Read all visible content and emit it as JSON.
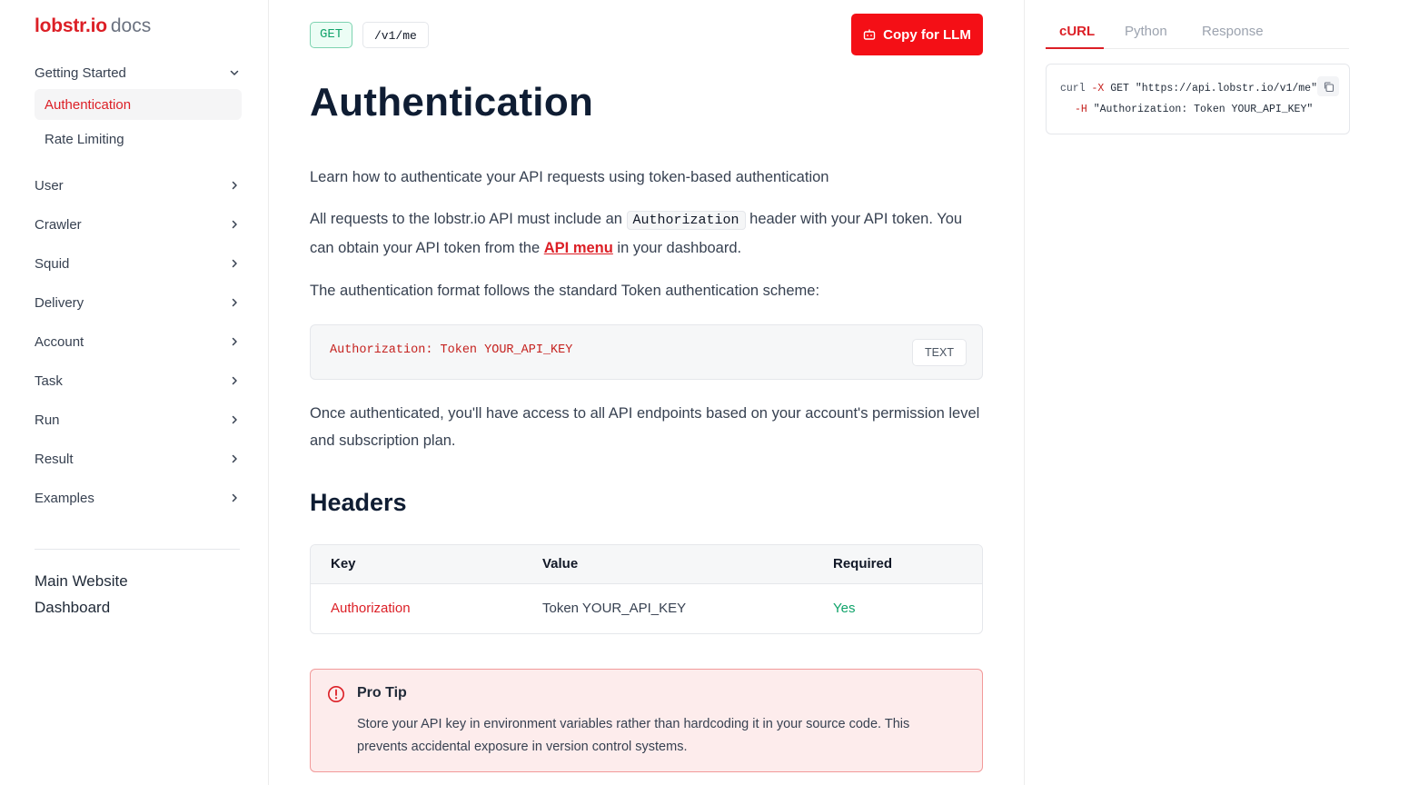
{
  "brand": {
    "logo": "lobstr.io",
    "suffix": "docs"
  },
  "sidebar": {
    "group": {
      "label": "Getting Started"
    },
    "sub_items": [
      {
        "label": "Authentication",
        "active": true
      },
      {
        "label": "Rate Limiting",
        "active": false
      }
    ],
    "items": [
      {
        "label": "User"
      },
      {
        "label": "Crawler"
      },
      {
        "label": "Squid"
      },
      {
        "label": "Delivery"
      },
      {
        "label": "Account"
      },
      {
        "label": "Task"
      },
      {
        "label": "Run"
      },
      {
        "label": "Result"
      },
      {
        "label": "Examples"
      }
    ],
    "footer_links": [
      {
        "label": "Main Website"
      },
      {
        "label": "Dashboard"
      }
    ]
  },
  "main": {
    "method": "GET",
    "path": "/v1/me",
    "copy_button": "Copy for LLM",
    "title": "Authentication",
    "intro": "Learn how to authenticate your API requests using token-based authentication",
    "para2": {
      "before": "All requests to the lobstr.io API must include an ",
      "code": "Authorization",
      "middle": " header with your API token. You can obtain your API token from the ",
      "link": "API menu",
      "after": " in your dashboard."
    },
    "para3": "The authentication format follows the standard Token authentication scheme:",
    "code_block": {
      "code": "Authorization: Token YOUR_API_KEY",
      "lang": "TEXT"
    },
    "para4": "Once authenticated, you'll have access to all API endpoints based on your account's permission level and subscription plan.",
    "headers_title": "Headers",
    "table": {
      "columns": [
        "Key",
        "Value",
        "Required"
      ],
      "rows": [
        {
          "key": "Authorization",
          "value": "Token YOUR_API_KEY",
          "required": "Yes"
        }
      ]
    },
    "tip": {
      "title": "Pro Tip",
      "body": "Store your API key in environment variables rather than hardcoding it in your source code. This prevents accidental exposure in version control systems."
    }
  },
  "right": {
    "tabs": [
      {
        "label": "cURL",
        "active": true
      },
      {
        "label": "Python",
        "active": false
      },
      {
        "label": "Response",
        "active": false
      }
    ],
    "snippet": {
      "line1_cmd": "curl",
      "line1_flag": "-X",
      "line1_rest": "GET \"https://api.lobstr.io/v1/me\" \\",
      "line2_flag": "-H",
      "line2_rest": "\"Authorization: Token YOUR_API_KEY\""
    }
  },
  "colors": {
    "accent": "#dc1f26",
    "button": "#f40f16",
    "success": "#10a36a"
  }
}
